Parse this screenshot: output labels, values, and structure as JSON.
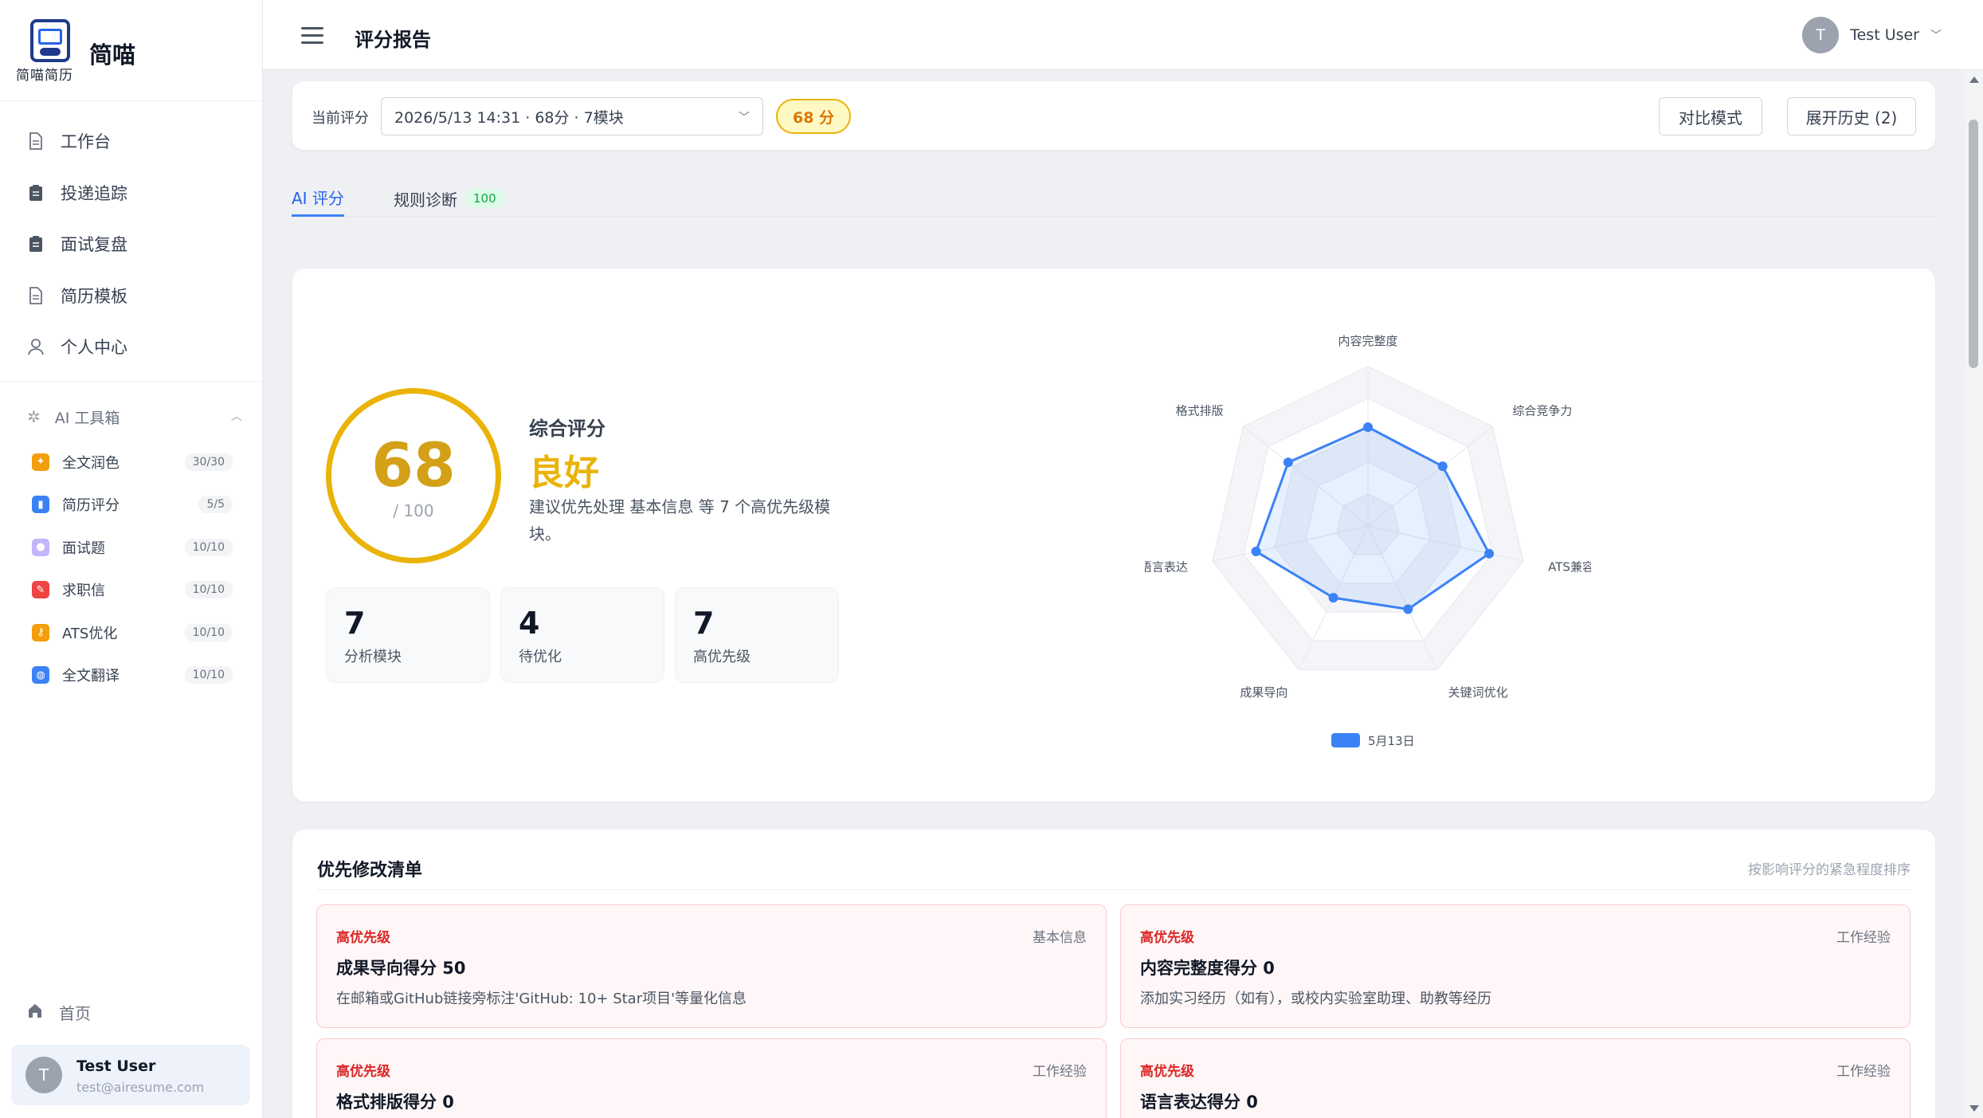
{
  "brand": {
    "name": "简喵",
    "sub": "简喵简历"
  },
  "nav": [
    {
      "label": "工作台",
      "icon": "document-icon"
    },
    {
      "label": "投递追踪",
      "icon": "clipboard-icon"
    },
    {
      "label": "面试复盘",
      "icon": "clipboard-icon"
    },
    {
      "label": "简历模板",
      "icon": "document-icon"
    },
    {
      "label": "个人中心",
      "icon": "user-icon"
    }
  ],
  "ai_toolbox": {
    "title": "AI 工具箱",
    "items": [
      {
        "label": "全文润色",
        "quota": "30/30",
        "icon": "sparkle-icon",
        "color": "#f59e0b"
      },
      {
        "label": "简历评分",
        "quota": "5/5",
        "icon": "bar-chart-icon",
        "color": "#3b82f6"
      },
      {
        "label": "面试题",
        "quota": "10/10",
        "icon": "chat-bubble-icon",
        "color": "#c4b5fd"
      },
      {
        "label": "求职信",
        "quota": "10/10",
        "icon": "letter-icon",
        "color": "#ef4444"
      },
      {
        "label": "ATS优化",
        "quota": "10/10",
        "icon": "key-icon",
        "color": "#f59e0b"
      },
      {
        "label": "全文翻译",
        "quota": "10/10",
        "icon": "globe-icon",
        "color": "#3b82f6"
      }
    ]
  },
  "home_label": "首页",
  "user": {
    "initial": "T",
    "name": "Test User",
    "email": "test@airesume.com"
  },
  "header": {
    "title": "评分报告"
  },
  "selector": {
    "label": "当前评分",
    "value": "2026/5/13 14:31 · 68分 · 7模块",
    "score_pill": "68 分",
    "compare_label": "对比模式",
    "history_label": "展开历史 (2)"
  },
  "tabs": {
    "ai": "AI 评分",
    "rule": "规则诊断",
    "rule_badge": "100"
  },
  "score": {
    "value": "68",
    "out_of": "/ 100",
    "verdict_label": "综合评分",
    "verdict": "良好",
    "advice": "建议优先处理 基本信息 等 7 个高优先级模块。",
    "ring_color": "#eab308"
  },
  "stats": [
    {
      "num": "7",
      "cap": "分析模块"
    },
    {
      "num": "4",
      "cap": "待优化"
    },
    {
      "num": "7",
      "cap": "高优先级"
    }
  ],
  "chart_data": {
    "type": "radar",
    "axes": [
      "内容完整度",
      "综合竞争力",
      "ATS兼容性",
      "关键词优化",
      "成果导向",
      "语言表达",
      "格式排版"
    ],
    "range": [
      0,
      100
    ],
    "series": [
      {
        "name": "5月13日",
        "values": [
          62,
          60,
          78,
          58,
          50,
          72,
          64
        ],
        "color": "#3b82f6"
      }
    ],
    "legend_position": "bottom"
  },
  "priority": {
    "title": "优先修改清单",
    "hint": "按影响评分的紧急程度排序",
    "items": [
      {
        "level": "高优先级",
        "category": "基本信息",
        "title": "成果导向得分 50",
        "desc": "在邮箱或GitHub链接旁标注'GitHub: 10+ Star项目'等量化信息"
      },
      {
        "level": "高优先级",
        "category": "工作经验",
        "title": "内容完整度得分 0",
        "desc": "添加实习经历（如有），或校内实验室助理、助教等经历"
      },
      {
        "level": "高优先级",
        "category": "工作经验",
        "title": "格式排版得分 0",
        "desc": ""
      },
      {
        "level": "高优先级",
        "category": "工作经验",
        "title": "语言表达得分 0",
        "desc": ""
      }
    ]
  }
}
